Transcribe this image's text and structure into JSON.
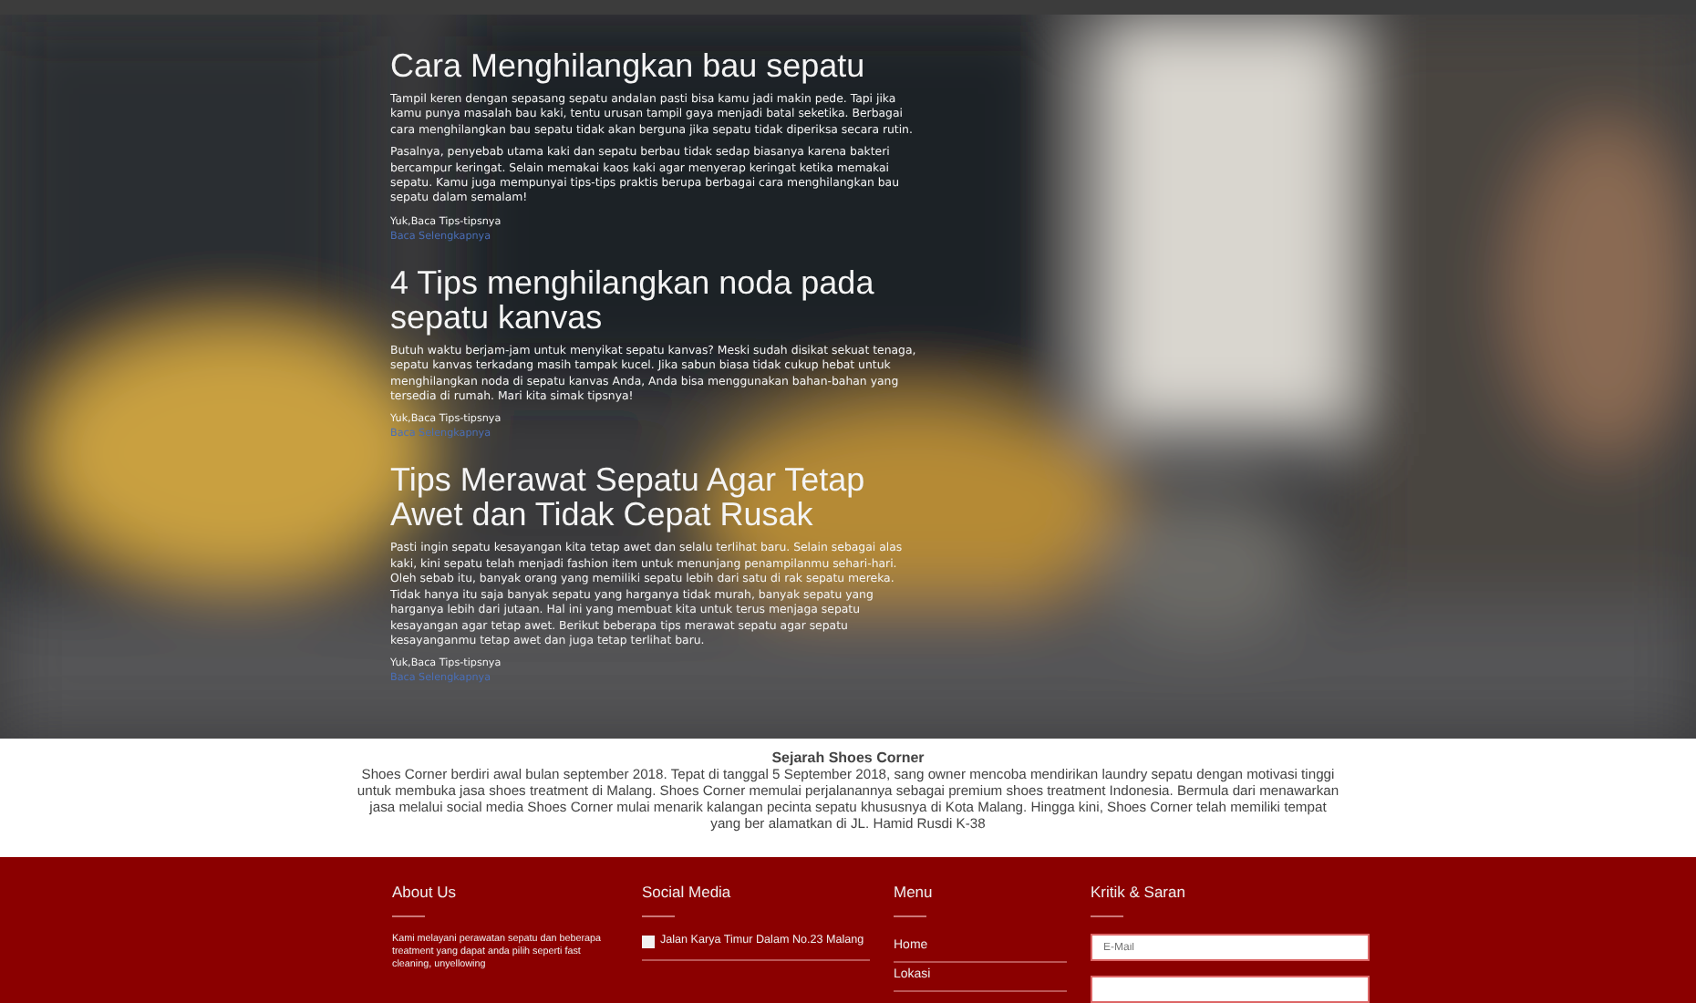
{
  "articles": [
    {
      "title": "Cara Menghilangkan bau sepatu",
      "paragraphs": [
        "Tampil keren dengan sepasang sepatu andalan pasti bisa kamu jadi makin pede. Tapi jika kamu punya masalah bau kaki, tentu urusan tampil gaya menjadi batal seketika. Berbagai cara menghilangkan bau sepatu tidak akan berguna jika sepatu tidak diperiksa secara rutin.",
        "Pasalnya, penyebab utama kaki dan sepatu berbau tidak sedap biasanya karena bakteri bercampur keringat. Selain memakai kaos kaki agar menyerap keringat ketika memakai sepatu. Kamu juga mempunyai tips-tips praktis berupa berbagai cara menghilangkan bau sepatu dalam semalam!"
      ],
      "teaser": "Yuk,Baca Tips-tipsnya",
      "link": "Baca Selengkapnya"
    },
    {
      "title": "4 Tips menghilangkan noda pada sepatu kanvas",
      "paragraphs": [
        "Butuh waktu berjam-jam untuk menyikat sepatu kanvas? Meski sudah disikat sekuat tenaga, sepatu kanvas terkadang masih tampak kucel. Jika sabun biasa tidak cukup hebat untuk menghilangkan noda di sepatu kanvas Anda, Anda bisa menggunakan bahan-bahan yang tersedia di rumah. Mari kita simak tipsnya!"
      ],
      "teaser": "Yuk,Baca Tips-tipsnya",
      "link": "Baca Selengkapnya"
    },
    {
      "title": "Tips Merawat Sepatu Agar Tetap Awet dan Tidak Cepat Rusak",
      "paragraphs": [
        "Pasti ingin sepatu kesayangan kita tetap awet dan selalu terlihat baru. Selain sebagai alas kaki, kini sepatu telah menjadi fashion item untuk menunjang penampilanmu sehari-hari. Oleh sebab itu, banyak orang yang memiliki sepatu lebih dari satu di rak sepatu mereka. Tidak hanya itu saja banyak sepatu yang harganya tidak murah, banyak sepatu yang harganya lebih dari jutaan. Hal ini yang membuat kita untuk terus menjaga sepatu kesayangan agar tetap awet. Berikut beberapa tips merawat sepatu agar sepatu kesayanganmu tetap awet dan juga tetap terlihat baru."
      ],
      "teaser": "Yuk,Baca Tips-tipsnya",
      "link": "Baca Selengkapnya"
    }
  ],
  "history": {
    "title": "Sejarah Shoes Corner",
    "text": "Shoes Corner berdiri awal bulan september 2018. Tepat di tanggal 5 September 2018, sang owner mencoba mendirikan laundry sepatu dengan motivasi tinggi untuk membuka jasa shoes treatment di Malang. Shoes Corner memulai perjalanannya sebagai premium shoes treatment Indonesia. Bermula dari menawarkan jasa melalui social media Shoes Corner mulai menarik kalangan pecinta sepatu khususnya di Kota Malang. Hingga kini, Shoes Corner telah memiliki tempat yang ber alamatkan di JL. Hamid Rusdi K-38"
  },
  "footer": {
    "about": {
      "title": "About Us",
      "text": "Kami melayani perawatan sepatu dan beberapa treatment yang dapat anda pilih seperti fast cleaning, unyellowing"
    },
    "social": {
      "title": "Social Media",
      "items": [
        "Jalan Karya Timur Dalam No.23 Malang"
      ]
    },
    "menu": {
      "title": "Menu",
      "items": [
        "Home",
        "Lokasi"
      ]
    },
    "feedback": {
      "title": "Kritik & Saran",
      "email_placeholder": "E-Mail"
    }
  }
}
